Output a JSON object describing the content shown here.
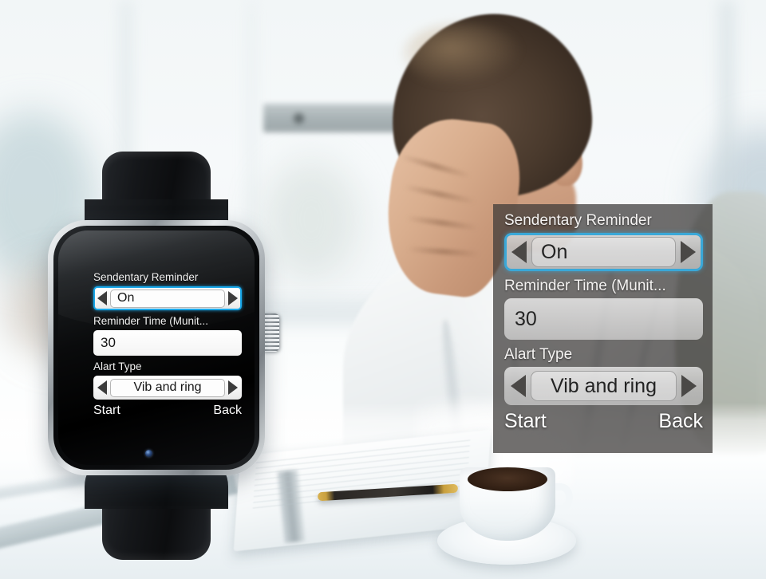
{
  "scene": {
    "description": "Smartwatch on office desk with frustrated man in background",
    "accent_blue": "#18a6e8",
    "overlay_accent_blue": "#3aa8d8",
    "watch_screen_bg": "#000000",
    "overlay_bg": "rgba(58,55,54,0.72)"
  },
  "watch": {
    "device_name": "smartwatch",
    "crown_name": "crown-button",
    "camera_name": "front-camera"
  },
  "settings_screen": {
    "rows": [
      {
        "id": "sendentary-reminder",
        "label": "Sendentary Reminder",
        "type": "spinner",
        "value": "On",
        "focused": true,
        "left_arrow": "previous-value-arrow",
        "right_arrow": "next-value-arrow"
      },
      {
        "id": "reminder-time",
        "label": "Reminder Time (Munit...",
        "type": "field",
        "value": "30",
        "focused": false
      },
      {
        "id": "alart-type",
        "label": "Alart Type",
        "type": "spinner",
        "value": "Vib and ring",
        "focused": false,
        "left_arrow": "previous-value-arrow",
        "right_arrow": "next-value-arrow"
      }
    ],
    "actions": {
      "primary": "Start",
      "secondary": "Back"
    }
  },
  "desk_items": {
    "notebook": "open-notebook",
    "pen": "pen",
    "cup": "coffee-cup",
    "saucer": "saucer"
  }
}
